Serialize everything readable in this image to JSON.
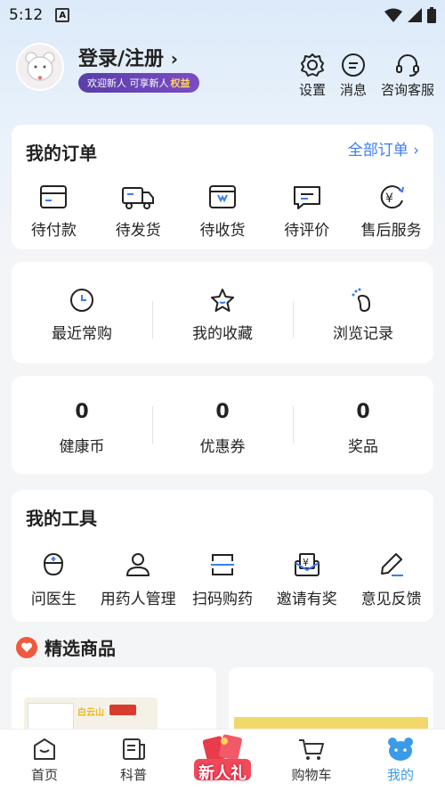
{
  "status": {
    "time": "5:12",
    "a_icon": "A"
  },
  "profile": {
    "login_label": "登录/注册",
    "badge_text": "欢迎新人 可享新人",
    "badge_highlight": "权益"
  },
  "top_actions": [
    {
      "label": "设置",
      "icon": "gear-icon"
    },
    {
      "label": "消息",
      "icon": "message-icon"
    },
    {
      "label": "咨询客服",
      "icon": "headset-icon"
    }
  ],
  "orders": {
    "title": "我的订单",
    "all_link": "全部订单",
    "items": [
      {
        "label": "待付款",
        "icon": "card-icon"
      },
      {
        "label": "待发货",
        "icon": "truck-icon"
      },
      {
        "label": "待收货",
        "icon": "box-icon"
      },
      {
        "label": "待评价",
        "icon": "comment-icon"
      },
      {
        "label": "售后服务",
        "icon": "yuan-refund-icon"
      }
    ]
  },
  "quick": {
    "items": [
      {
        "label": "最近常购",
        "icon": "clock-icon"
      },
      {
        "label": "我的收藏",
        "icon": "star-icon"
      },
      {
        "label": "浏览记录",
        "icon": "footprint-icon"
      }
    ]
  },
  "assets": {
    "items": [
      {
        "value": "0",
        "label": "健康币"
      },
      {
        "value": "0",
        "label": "优惠券"
      },
      {
        "value": "0",
        "label": "奖品"
      }
    ]
  },
  "tools": {
    "title": "我的工具",
    "items": [
      {
        "label": "问医生",
        "icon": "doctor-icon"
      },
      {
        "label": "用药人管理",
        "icon": "user-icon"
      },
      {
        "label": "扫码购药",
        "icon": "scan-icon"
      },
      {
        "label": "邀请有奖",
        "icon": "envelope-yuan-icon"
      },
      {
        "label": "意见反馈",
        "icon": "pen-icon"
      }
    ]
  },
  "featured": {
    "title": "精选商品",
    "product_brand": "白云山"
  },
  "tabbar": {
    "items": [
      {
        "label": "首页",
        "icon": "home-icon"
      },
      {
        "label": "科普",
        "icon": "article-icon"
      },
      {
        "label": "新人礼",
        "icon": "gift-icon"
      },
      {
        "label": "购物车",
        "icon": "cart-icon"
      },
      {
        "label": "我的",
        "icon": "bear-icon"
      }
    ],
    "active_color": "#3a9be8"
  },
  "colors": {
    "accent": "#3a7cf2",
    "badge": "#5a3ea8",
    "heart": "#f05a3c"
  }
}
